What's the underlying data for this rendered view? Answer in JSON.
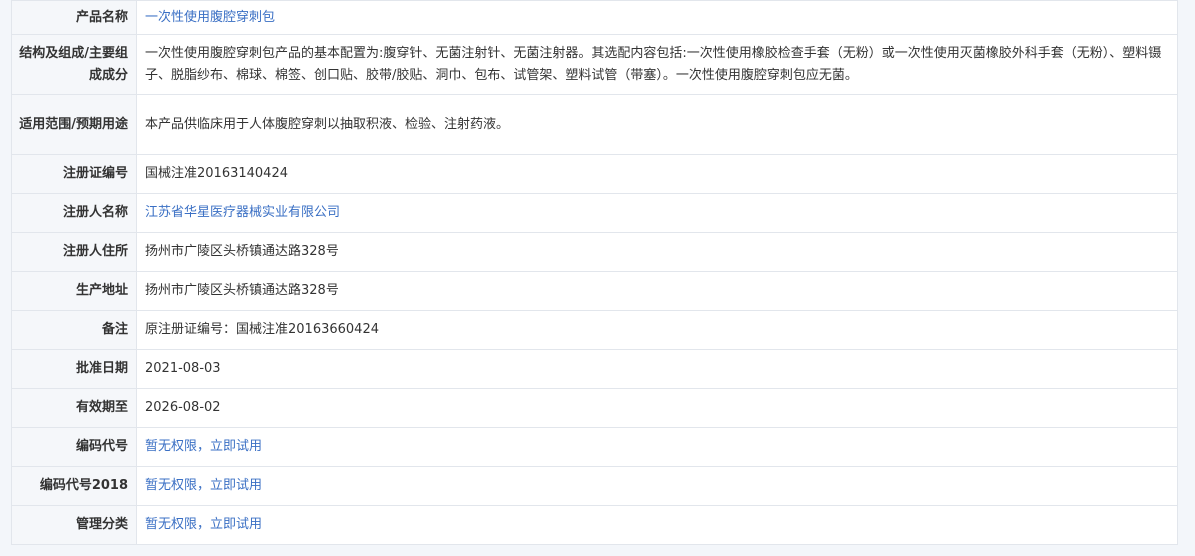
{
  "rows": [
    {
      "label": "产品名称",
      "value": "一次性使用腹腔穿刺包",
      "link": true,
      "key": "product-name"
    },
    {
      "label": "结构及组成/主要组成成分",
      "value": "一次性使用腹腔穿刺包产品的基本配置为:腹穿针、无菌注射针、无菌注射器。其选配内容包括:一次性使用橡胶检查手套（无粉）或一次性使用灭菌橡胶外科手套（无粉）、塑料镊子、脱脂纱布、棉球、棉签、创口贴、胶带/胶贴、洞巾、包布、试管架、塑料试管（带塞）。一次性使用腹腔穿刺包应无菌。",
      "link": false,
      "key": "composition"
    },
    {
      "label": "适用范围/预期用途",
      "value": "本产品供临床用于人体腹腔穿刺以抽取积液、检验、注射药液。",
      "link": false,
      "key": "intended-use"
    },
    {
      "label": "注册证编号",
      "value": "国械注准20163140424",
      "link": false,
      "key": "registration-no"
    },
    {
      "label": "注册人名称",
      "value": "江苏省华星医疗器械实业有限公司",
      "link": true,
      "key": "registrant-name"
    },
    {
      "label": "注册人住所",
      "value": "扬州市广陵区头桥镇通达路328号",
      "link": false,
      "key": "registrant-address"
    },
    {
      "label": "生产地址",
      "value": "扬州市广陵区头桥镇通达路328号",
      "link": false,
      "key": "production-address"
    },
    {
      "label": "备注",
      "value": "原注册证编号：国械注准20163660424",
      "link": false,
      "key": "remarks"
    },
    {
      "label": "批准日期",
      "value": "2021-08-03",
      "link": false,
      "key": "approval-date"
    },
    {
      "label": "有效期至",
      "value": "2026-08-02",
      "link": false,
      "key": "expiry-date"
    },
    {
      "label": "编码代号",
      "value": "暂无权限，立即试用",
      "link": true,
      "key": "code"
    },
    {
      "label": "编码代号2018",
      "value": "暂无权限，立即试用",
      "link": true,
      "key": "code-2018"
    },
    {
      "label": "管理分类",
      "value": "暂无权限，立即试用",
      "link": true,
      "key": "management-class"
    }
  ]
}
